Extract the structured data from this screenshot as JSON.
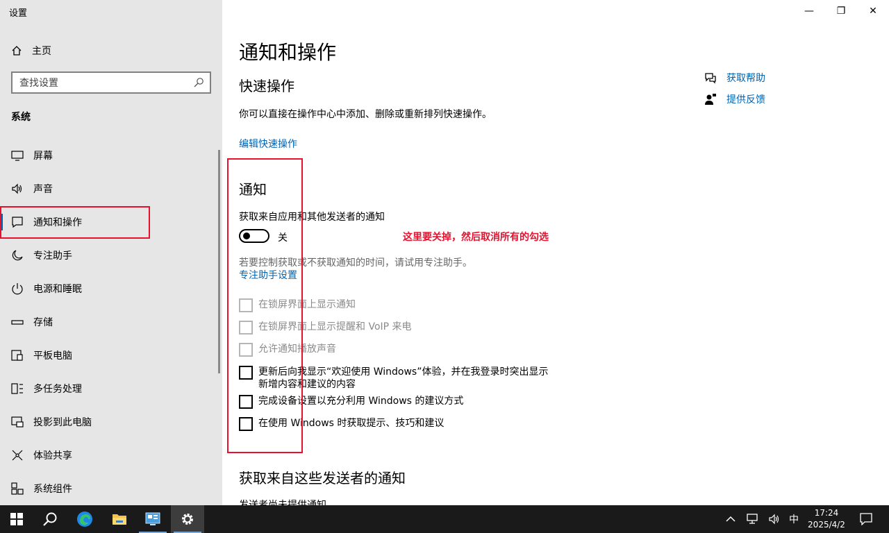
{
  "window": {
    "app_title": "设置",
    "minimize_label": "—",
    "restore_label": "❐",
    "close_label": "✕"
  },
  "sidebar": {
    "home_label": "主页",
    "search_placeholder": "查找设置",
    "section_label": "系统",
    "items": [
      {
        "label": "屏幕",
        "icon": "monitor-icon"
      },
      {
        "label": "声音",
        "icon": "speaker-icon"
      },
      {
        "label": "通知和操作",
        "icon": "notification-icon",
        "selected": true
      },
      {
        "label": "专注助手",
        "icon": "moon-icon"
      },
      {
        "label": "电源和睡眠",
        "icon": "power-icon"
      },
      {
        "label": "存储",
        "icon": "storage-icon"
      },
      {
        "label": "平板电脑",
        "icon": "tablet-icon"
      },
      {
        "label": "多任务处理",
        "icon": "multitask-icon"
      },
      {
        "label": "投影到此电脑",
        "icon": "project-icon"
      },
      {
        "label": "体验共享",
        "icon": "share-icon"
      },
      {
        "label": "系统组件",
        "icon": "components-icon"
      }
    ]
  },
  "main": {
    "page_title": "通知和操作",
    "quick_actions": {
      "heading": "快速操作",
      "description": "你可以直接在操作中心中添加、删除或重新排列快速操作。",
      "edit_link": "编辑快速操作"
    },
    "notifications": {
      "heading": "通知",
      "toggle_caption": "获取来自应用和其他发送者的通知",
      "toggle_state": "关",
      "toggle_on": false,
      "focus_hint": "若要控制获取或不获取通知的时间，请试用专注助手。",
      "focus_link": "专注助手设置",
      "annotation": "这里要关掉，然后取消所有的勾选",
      "checkboxes": [
        {
          "line1": "在锁屏界面上显示通知",
          "line2": "",
          "checked": false,
          "disabled": true
        },
        {
          "line1": "在锁屏界面上显示提醒和 VoIP 来电",
          "line2": "",
          "checked": false,
          "disabled": true
        },
        {
          "line1": "允许通知播放声音",
          "line2": "",
          "checked": false,
          "disabled": true
        },
        {
          "line1": "更新后向我显示“欢迎使用 Windows”体验，并在我登录时突出显示",
          "line2": "新增内容和建议的内容",
          "checked": false,
          "disabled": false
        },
        {
          "line1": "完成设备设置以充分利用 Windows 的建议方式",
          "line2": "",
          "checked": false,
          "disabled": false
        },
        {
          "line1": "在使用 Windows 时获取提示、技巧和建议",
          "line2": "",
          "checked": false,
          "disabled": false
        }
      ]
    },
    "senders": {
      "heading": "获取来自这些发送者的通知",
      "partial_text": "发送者尚未提供通知"
    },
    "help": {
      "get_help": "获取帮助",
      "feedback": "提供反馈"
    }
  },
  "taskbar": {
    "apps": [
      "start-icon",
      "search-icon",
      "edge-icon",
      "file-explorer-icon",
      "control-panel-icon",
      "settings-icon"
    ],
    "ime": "中",
    "time": "17:24",
    "date": "2025/4/2"
  },
  "colors": {
    "accent": "#0063b1",
    "annotation_red": "#e8112d",
    "sidebar_bg": "#e6e6e6",
    "taskbar_bg": "#1a1a1a"
  }
}
